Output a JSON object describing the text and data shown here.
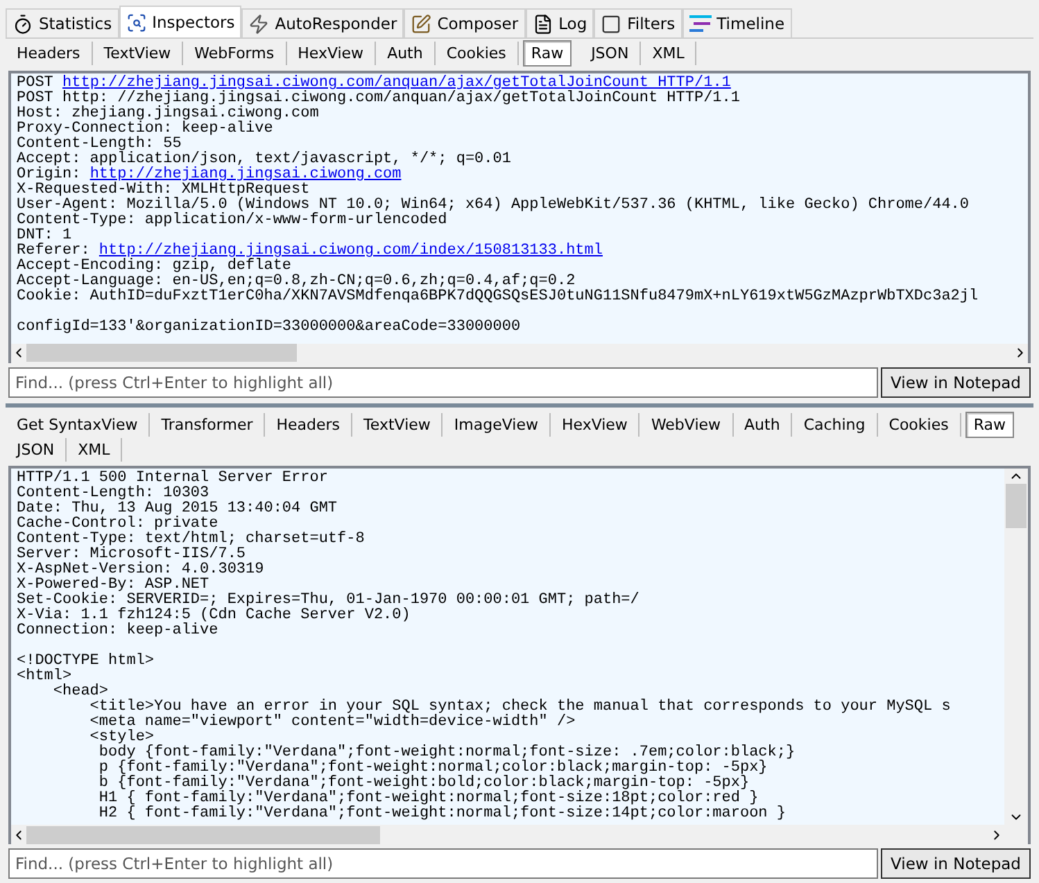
{
  "main_tabs": [
    {
      "label": "Statistics",
      "kind": "stopwatch",
      "selected": false
    },
    {
      "label": "Inspectors",
      "kind": "inspect",
      "selected": true
    },
    {
      "label": "AutoResponder",
      "kind": "bolt",
      "selected": false
    },
    {
      "label": "Composer",
      "kind": "compose",
      "selected": false
    },
    {
      "label": "Log",
      "kind": "log",
      "selected": false
    },
    {
      "label": "Filters",
      "kind": "filters",
      "selected": false
    },
    {
      "label": "Timeline",
      "kind": "timeline",
      "selected": false
    }
  ],
  "request": {
    "tabs": [
      {
        "label": "Headers",
        "selected": false
      },
      {
        "label": "TextView",
        "selected": false
      },
      {
        "label": "WebForms",
        "selected": false
      },
      {
        "label": "HexView",
        "selected": false
      },
      {
        "label": "Auth",
        "selected": false
      },
      {
        "label": "Cookies",
        "selected": false
      },
      {
        "label": "Raw",
        "selected": true
      },
      {
        "label": "JSON",
        "selected": false
      },
      {
        "label": "XML",
        "selected": false
      }
    ],
    "lines": [
      {
        "text": "POST ",
        "link": "http://zhejiang.jingsai.ciwong.com/anquan/ajax/getTotalJoinCount HTTP/1.1"
      },
      {
        "text": "POST http: //zhejiang.jingsai.ciwong.com/anquan/ajax/getTotalJoinCount HTTP/1.1"
      },
      {
        "text": "Host: zhejiang.jingsai.ciwong.com"
      },
      {
        "text": "Proxy-Connection: keep-alive"
      },
      {
        "text": "Content-Length: 55"
      },
      {
        "text": "Accept: application/json, text/javascript, */*; q=0.01"
      },
      {
        "text": "Origin: ",
        "link": "http://zhejiang.jingsai.ciwong.com"
      },
      {
        "text": "X-Requested-With: XMLHttpRequest"
      },
      {
        "text": "User-Agent: Mozilla/5.0 (Windows NT 10.0; Win64; x64) AppleWebKit/537.36 (KHTML, like Gecko) Chrome/44.0"
      },
      {
        "text": "Content-Type: application/x-www-form-urlencoded"
      },
      {
        "text": "DNT: 1"
      },
      {
        "text": "Referer: ",
        "link": "http://zhejiang.jingsai.ciwong.com/index/150813133.html"
      },
      {
        "text": "Accept-Encoding: gzip, deflate"
      },
      {
        "text": "Accept-Language: en-US,en;q=0.8,zh-CN;q=0.6,zh;q=0.4,af;q=0.2"
      },
      {
        "text": "Cookie: AuthID=duFxztT1erC0ha/XKN7AVSMdfenqa6BPK7dQQGSQsESJ0tuNG11SNfu8479mX+nLY619xtW5GzMAzprWbTXDc3a2jl"
      },
      {
        "text": "configId=133'&organizationID=33000000&areaCode=33000000",
        "gap_before": true
      }
    ],
    "find": {
      "placeholder": "Find... (press Ctrl+Enter to highlight all)"
    },
    "button": "View in Notepad"
  },
  "response": {
    "tabs": [
      {
        "label": "Get SyntaxView",
        "selected": false
      },
      {
        "label": "Transformer",
        "selected": false
      },
      {
        "label": "Headers",
        "selected": false
      },
      {
        "label": "TextView",
        "selected": false
      },
      {
        "label": "ImageView",
        "selected": false
      },
      {
        "label": "HexView",
        "selected": false
      },
      {
        "label": "WebView",
        "selected": false
      },
      {
        "label": "Auth",
        "selected": false
      },
      {
        "label": "Caching",
        "selected": false
      },
      {
        "label": "Cookies",
        "selected": false
      },
      {
        "label": "Raw",
        "selected": true
      },
      {
        "label": "JSON",
        "selected": false
      },
      {
        "label": "XML",
        "selected": false
      }
    ],
    "lines": [
      {
        "text": "HTTP/1.1 500 Internal Server Error"
      },
      {
        "text": "Content-Length: 10303"
      },
      {
        "text": "Date: Thu, 13 Aug 2015 13:40:04 GMT"
      },
      {
        "text": "Cache-Control: private"
      },
      {
        "text": "Content-Type: text/html; charset=utf-8"
      },
      {
        "text": "Server: Microsoft-IIS/7.5"
      },
      {
        "text": "X-AspNet-Version: 4.0.30319"
      },
      {
        "text": "X-Powered-By: ASP.NET"
      },
      {
        "text": "Set-Cookie: SERVERID=; Expires=Thu, 01-Jan-1970 00:00:01 GMT; path=/"
      },
      {
        "text": "X-Via: 1.1 fzh124:5 (Cdn Cache Server V2.0)"
      },
      {
        "text": "Connection: keep-alive"
      },
      {
        "text": "<!DOCTYPE html>",
        "gap_before": true
      },
      {
        "text": "<html>"
      },
      {
        "text": "    <head>"
      },
      {
        "text": "        <title>You have an error in your SQL syntax; check the manual that corresponds to your MySQL s"
      },
      {
        "text": "        <meta name=\"viewport\" content=\"width=device-width\" />"
      },
      {
        "text": "        <style>"
      },
      {
        "text": "         body {font-family:\"Verdana\";font-weight:normal;font-size: .7em;color:black;}"
      },
      {
        "text": "         p {font-family:\"Verdana\";font-weight:normal;color:black;margin-top: -5px}"
      },
      {
        "text": "         b {font-family:\"Verdana\";font-weight:bold;color:black;margin-top: -5px}"
      },
      {
        "text": "         H1 { font-family:\"Verdana\";font-weight:normal;font-size:18pt;color:red }"
      },
      {
        "text": "         H2 { font-family:\"Verdana\";font-weight:normal;font-size:14pt;color:maroon }"
      }
    ],
    "find": {
      "placeholder": "Find... (press Ctrl+Enter to highlight all)"
    },
    "button": "View in Notepad"
  }
}
